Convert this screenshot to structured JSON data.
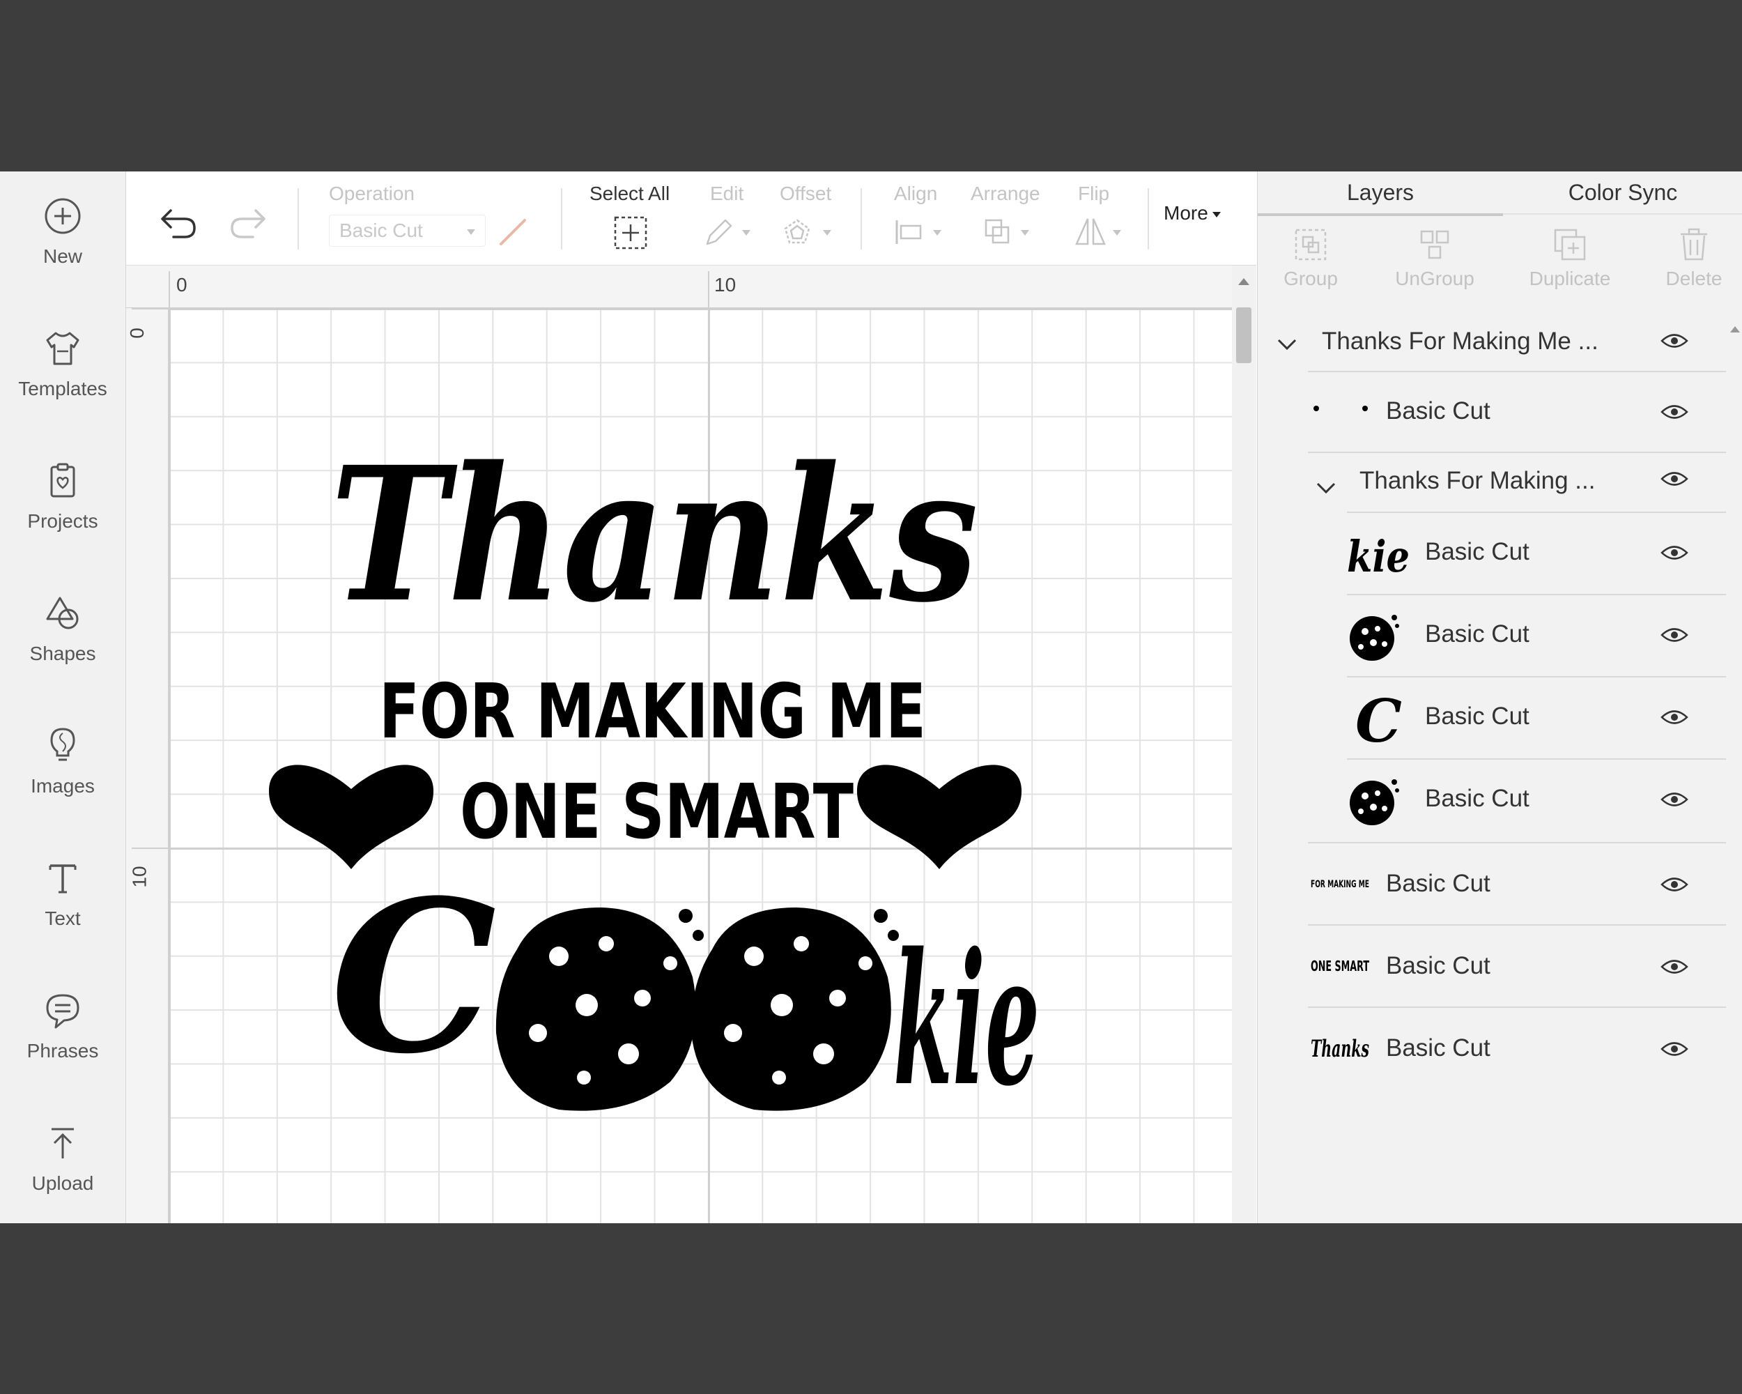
{
  "sidebar": {
    "items": [
      {
        "label": "New",
        "icon": "plus-circle-icon"
      },
      {
        "label": "Templates",
        "icon": "shirt-icon"
      },
      {
        "label": "Projects",
        "icon": "clipboard-icon"
      },
      {
        "label": "Shapes",
        "icon": "shapes-icon"
      },
      {
        "label": "Images",
        "icon": "lightbulb-icon"
      },
      {
        "label": "Text",
        "icon": "text-t-icon"
      },
      {
        "label": "Phrases",
        "icon": "speech-bubble-icon"
      },
      {
        "label": "Upload",
        "icon": "upload-arrow-icon"
      }
    ]
  },
  "toolbar": {
    "operation_label": "Operation",
    "operation_value": "Basic Cut",
    "select_all_label": "Select All",
    "edit_label": "Edit",
    "offset_label": "Offset",
    "align_label": "Align",
    "arrange_label": "Arrange",
    "flip_label": "Flip",
    "more_label": "More"
  },
  "rulers": {
    "top_marks": [
      "0",
      "10"
    ],
    "left_marks": [
      "0",
      "10"
    ]
  },
  "design": {
    "line1": "Thanks",
    "line2": "FOR MAKING ME",
    "line3": "ONE SMART",
    "line4_start": "C",
    "line4_end": "kie"
  },
  "panel": {
    "tabs": {
      "layers": "Layers",
      "color_sync": "Color Sync"
    },
    "actions": {
      "group": "Group",
      "ungroup": "UnGroup",
      "duplicate": "Duplicate",
      "delete": "Delete"
    },
    "layers": {
      "group_top": "Thanks For Making Me ...",
      "dot_layer": "Basic Cut",
      "group_inner": "Thanks For Making ...",
      "inner": [
        {
          "label": "Basic Cut",
          "thumb": "kie"
        },
        {
          "label": "Basic Cut",
          "thumb": "cookie"
        },
        {
          "label": "Basic Cut",
          "thumb": "C"
        },
        {
          "label": "Basic Cut",
          "thumb": "cookie"
        }
      ],
      "bottom": [
        {
          "label": "Basic Cut",
          "thumb": "FOR MAKING ME"
        },
        {
          "label": "Basic Cut",
          "thumb": "ONE SMART"
        },
        {
          "label": "Basic Cut",
          "thumb": "Thanks"
        }
      ]
    }
  },
  "colors": {
    "accent_slash": "#e9b8a8",
    "panel_bg": "#f2f2f2",
    "sidebar_bg": "#f1f1f1",
    "design_ink": "#000000"
  }
}
